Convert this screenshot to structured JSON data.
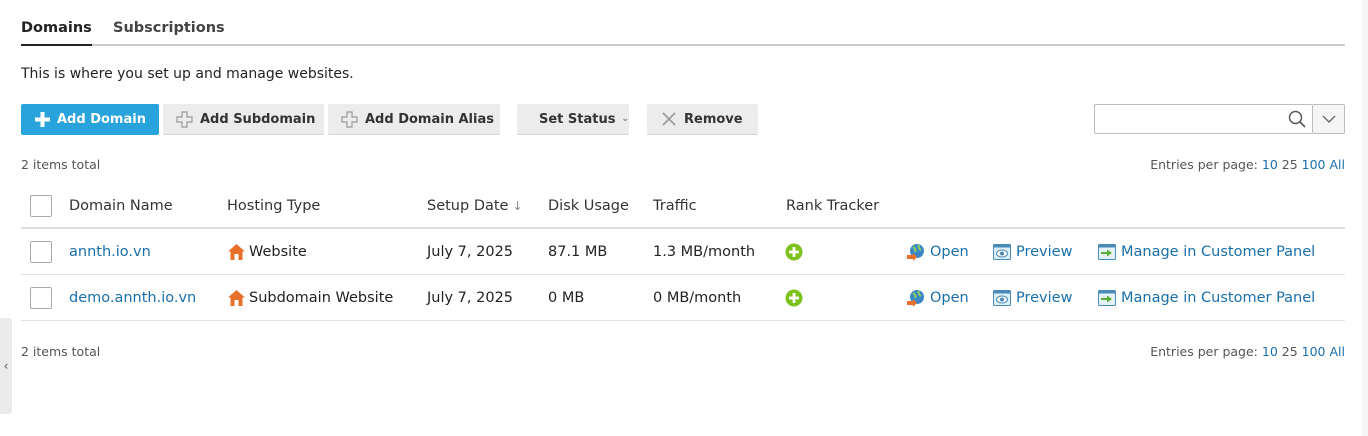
{
  "tabs": [
    {
      "label": "Domains",
      "active": true
    },
    {
      "label": "Subscriptions",
      "active": false
    }
  ],
  "intro_text": "This is where you set up and manage websites.",
  "toolbar": {
    "add_domain": "Add Domain",
    "add_subdomain": "Add Subdomain",
    "add_domain_alias": "Add Domain Alias",
    "set_status": "Set Status",
    "remove": "Remove"
  },
  "search": {
    "value": "",
    "placeholder": ""
  },
  "summary": {
    "items_total": "2 items total",
    "entries_label": "Entries per page:",
    "entries_options": [
      "10",
      "25",
      "100",
      "All"
    ]
  },
  "table": {
    "columns": [
      "Domain Name",
      "Hosting Type",
      "Setup Date",
      "Disk Usage",
      "Traffic",
      "Rank Tracker"
    ],
    "sort_indicator": "↓",
    "rows": [
      {
        "domain": "annth.io.vn",
        "hosting_type": "Website",
        "setup_date": "July 7, 2025",
        "disk_usage": "87.1 MB",
        "traffic": "1.3 MB/month",
        "open": "Open",
        "preview": "Preview",
        "manage": "Manage in Customer Panel"
      },
      {
        "domain": "demo.annth.io.vn",
        "hosting_type": "Subdomain Website",
        "setup_date": "July 7, 2025",
        "disk_usage": "0 MB",
        "traffic": "0 MB/month",
        "open": "Open",
        "preview": "Preview",
        "manage": "Manage in Customer Panel"
      }
    ]
  },
  "icons": {
    "add": "plus-icon",
    "home": "home-icon",
    "rank": "plus-circle-icon",
    "open": "globe-arrow-icon",
    "preview": "eye-icon",
    "manage": "panel-arrow-icon"
  },
  "colors": {
    "accent": "#29a3dc",
    "link": "#1a6fa8",
    "rank_green": "#7cc21d",
    "home_orange": "#e8702a"
  },
  "side_handle": "‹"
}
